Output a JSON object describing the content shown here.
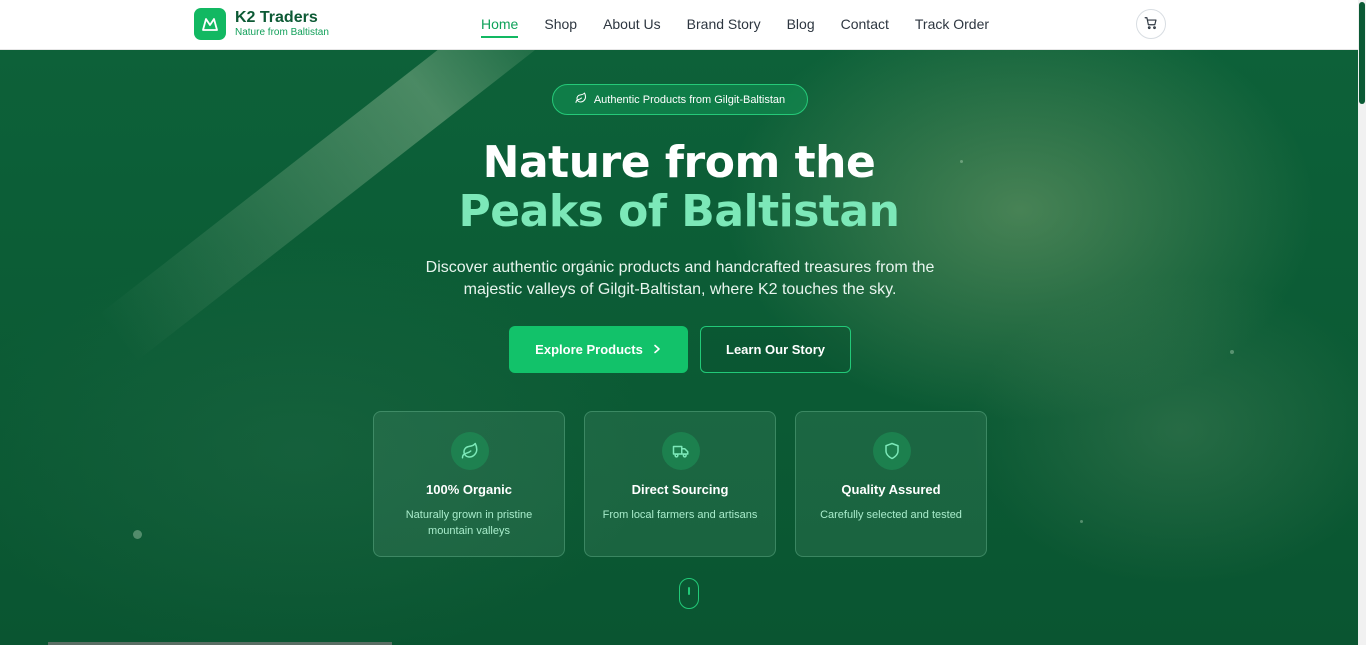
{
  "header": {
    "logo_title": "K2 Traders",
    "logo_subtitle": "Nature from Baltistan",
    "nav": [
      {
        "label": "Home",
        "active": true
      },
      {
        "label": "Shop",
        "active": false
      },
      {
        "label": "About Us",
        "active": false
      },
      {
        "label": "Brand Story",
        "active": false
      },
      {
        "label": "Blog",
        "active": false
      },
      {
        "label": "Contact",
        "active": false
      },
      {
        "label": "Track Order",
        "active": false
      }
    ],
    "cart_icon": "shopping-cart-icon"
  },
  "hero": {
    "badge": "Authentic Products from Gilgit-Baltistan",
    "badge_icon": "leaf-icon",
    "title_line1": "Nature from the",
    "title_line2": "Peaks of Baltistan",
    "description": "Discover authentic organic products and handcrafted treasures from the majestic valleys of Gilgit-Baltistan, where K2 touches the sky.",
    "primary_button": "Explore Products",
    "secondary_button": "Learn Our Story"
  },
  "features": [
    {
      "icon": "leaf-icon",
      "title": "100% Organic",
      "description": "Naturally grown in pristine mountain valleys"
    },
    {
      "icon": "truck-icon",
      "title": "Direct Sourcing",
      "description": "From local farmers and artisans"
    },
    {
      "icon": "shield-icon",
      "title": "Quality Assured",
      "description": "Carefully selected and tested"
    }
  ],
  "colors": {
    "brand_green": "#12c26a",
    "hero_background": "#0b5a35",
    "accent_text": "#7ce8b8"
  }
}
